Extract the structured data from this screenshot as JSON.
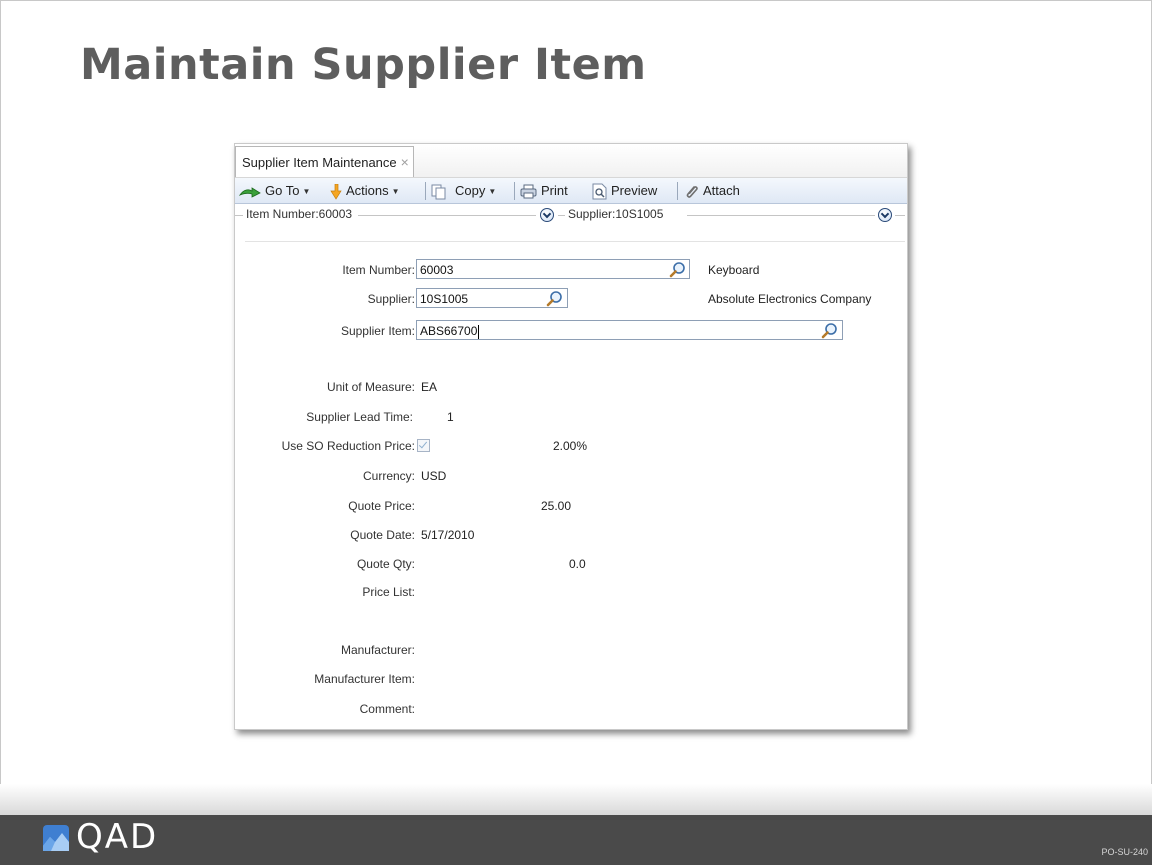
{
  "slide": {
    "title": "Maintain Supplier Item",
    "slide_code": "PO-SU-240",
    "brand": "QAD"
  },
  "window": {
    "tab_label": "Supplier Item Maintenance",
    "tab_close": "×",
    "toolbar": {
      "goto": "Go To",
      "actions": "Actions",
      "copy": "Copy",
      "print": "Print",
      "preview": "Preview",
      "attach": "Attach"
    },
    "header": {
      "item_number": "Item Number:60003",
      "supplier": "Supplier:10S1005"
    }
  },
  "form": {
    "item_number": {
      "label": "Item Number:",
      "value": "60003",
      "desc": "Keyboard"
    },
    "supplier": {
      "label": "Supplier:",
      "value": "10S1005",
      "desc": "Absolute Electronics Company"
    },
    "supplier_item": {
      "label": "Supplier Item:",
      "value": "ABS66700"
    },
    "uom": {
      "label": "Unit of Measure:",
      "value": "EA"
    },
    "lead_time": {
      "label": "Supplier Lead Time:",
      "value": "1"
    },
    "so_reduction": {
      "label": "Use SO Reduction Price:",
      "checked": true,
      "value": "2.00%"
    },
    "currency": {
      "label": "Currency:",
      "value": "USD"
    },
    "quote_price": {
      "label": "Quote Price:",
      "value": "25.00"
    },
    "quote_date": {
      "label": "Quote Date:",
      "value": "5/17/2010"
    },
    "quote_qty": {
      "label": "Quote Qty:",
      "value": "0.0"
    },
    "price_list": {
      "label": "Price List:"
    },
    "manufacturer": {
      "label": "Manufacturer:"
    },
    "manufacturer_item": {
      "label": "Manufacturer Item:"
    },
    "comment": {
      "label": "Comment:"
    }
  }
}
